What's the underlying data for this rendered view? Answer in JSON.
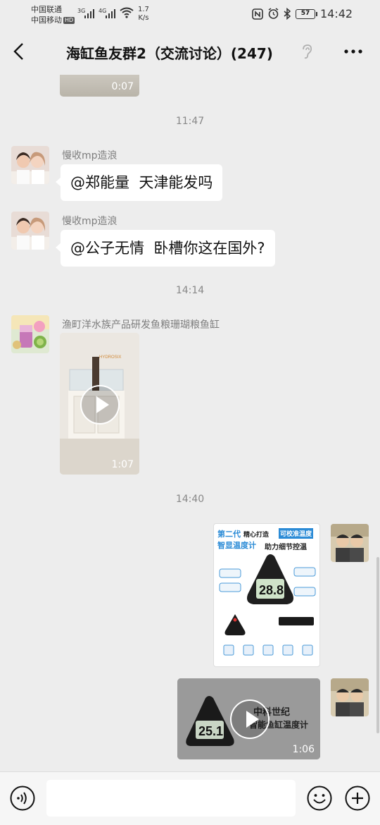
{
  "status_bar": {
    "carrier1": "中国联通",
    "carrier2": "中国移动",
    "hd_badge": "HD",
    "signal1_label": "3G",
    "signal2_label": "4G",
    "net_speed_value": "1.7",
    "net_speed_unit": "K/s",
    "battery": "57",
    "time": "14:42",
    "icons": [
      "nfc-icon",
      "alarm-icon",
      "bluetooth-icon",
      "wifi-icon",
      "signal-icon"
    ]
  },
  "header": {
    "title": "海缸鱼友群2（交流讨论）(247)",
    "back_icon": "chevron-left-icon",
    "mute_icon": "ear-icon",
    "more_icon": "more-dots-icon"
  },
  "messages": {
    "m0": {
      "duration": "0:07"
    },
    "ts1": "11:47",
    "m1": {
      "sender": "慢收mp造浪",
      "text": "@郑能量  天津能发吗"
    },
    "m2": {
      "sender": "慢收mp造浪",
      "text": "@公子无情  卧槽你这在国外?"
    },
    "ts2": "14:14",
    "m3": {
      "sender": "渔町洋水族产品研发鱼粮珊瑚粮鱼缸",
      "duration": "1:07"
    },
    "ts3": "14:40",
    "m4": {
      "type": "image",
      "line1a": "第二代",
      "line1b": "精心打造",
      "line1c": "可校准温度",
      "line2a": "智显温度计",
      "line2b": "助力细节控温",
      "display": "28.8"
    },
    "m5": {
      "duration": "1:06",
      "title_line1": "中科世纪",
      "title_line2": "智能鱼缸温度计",
      "display": "25.1"
    }
  },
  "input_bar": {
    "placeholder": "",
    "voice_icon": "voice-icon",
    "emoji_icon": "emoji-icon",
    "plus_icon": "plus-icon"
  },
  "colors": {
    "background": "#ededed",
    "bubble": "#ffffff",
    "timestamp": "#888888",
    "sender": "#7d7d7d"
  }
}
